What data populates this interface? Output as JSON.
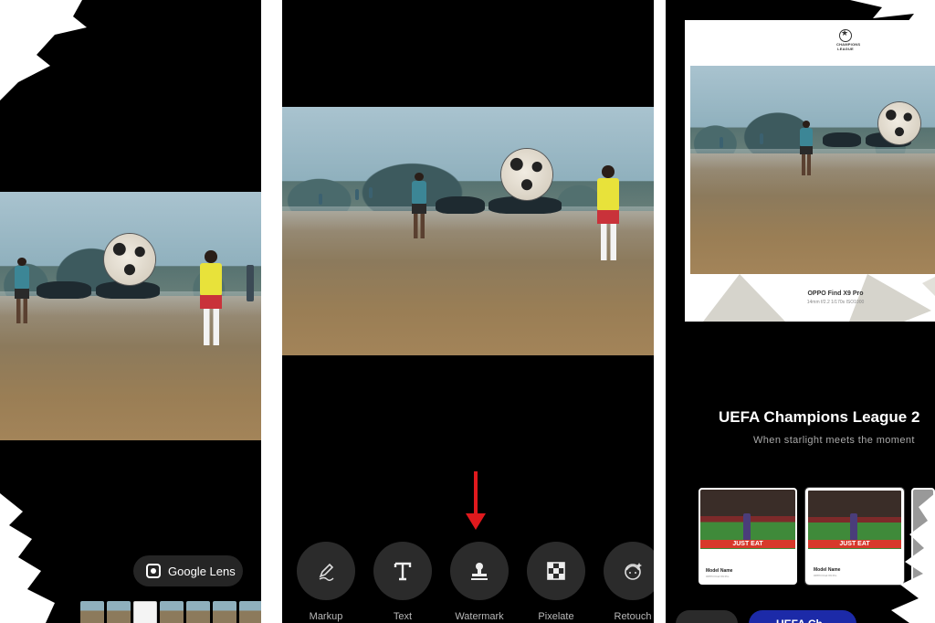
{
  "left_panel": {
    "google_lens_label": "Google Lens"
  },
  "middle_panel": {
    "tools": [
      {
        "label": "Markup",
        "icon": "pencil-icon"
      },
      {
        "label": "Text",
        "icon": "text-t-icon"
      },
      {
        "label": "Watermark",
        "icon": "stamp-icon"
      },
      {
        "label": "Pixelate",
        "icon": "mosaic-icon"
      },
      {
        "label": "Retouch",
        "icon": "face-retouch-icon"
      }
    ],
    "highlight_color": "#e0191d"
  },
  "right_panel": {
    "logo_text": "CHAMPIONS LEAGUE",
    "device_name": "OPPO Find X9 Pro",
    "camera_specs": "14mm  f/2.2  1/170s  ISO1000",
    "watermark_title": "UEFA Champions League 2",
    "watermark_subtitle": "When starlight meets the moment",
    "templates": [
      {
        "banner": "JUST EAT",
        "model_name": "Model Name",
        "sub": "OPPO Find X9 Pro"
      },
      {
        "banner": "JUST EAT",
        "model_name": "Model Name",
        "sub": "OPPO Find X9 Pro"
      }
    ],
    "primary_button_label": "UEFA Ch",
    "accent_color": "#1c2aa8"
  }
}
